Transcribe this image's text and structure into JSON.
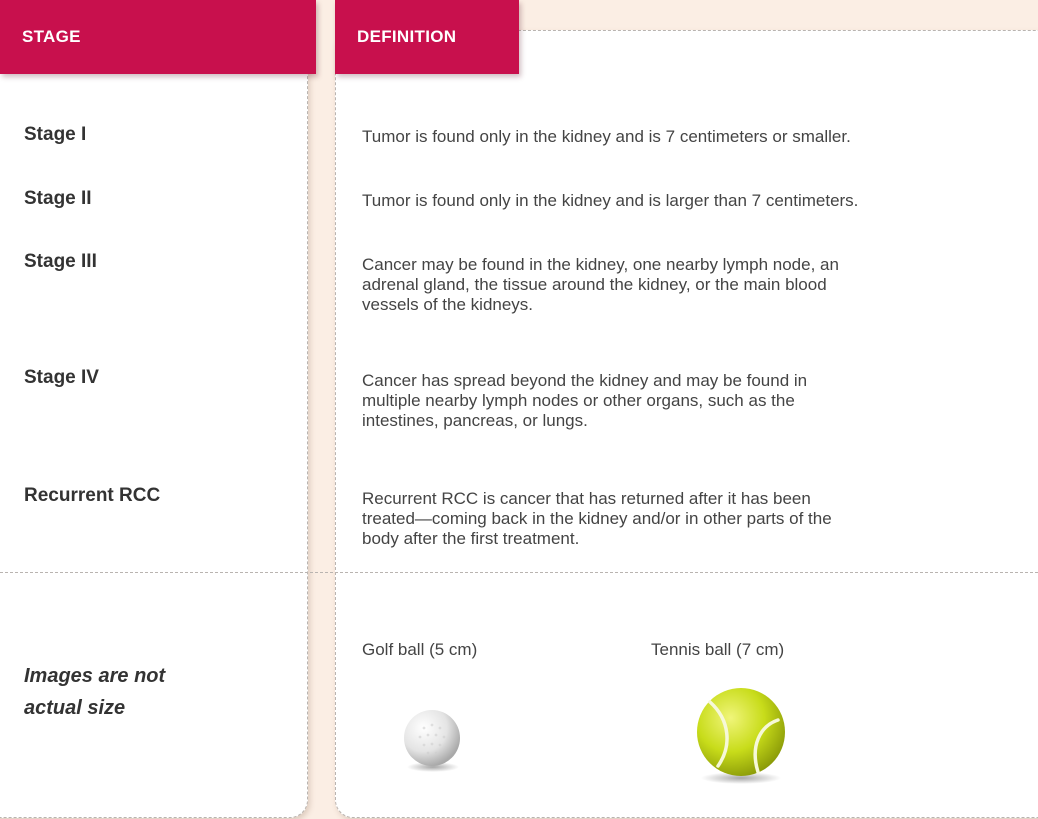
{
  "headers": {
    "stage": "STAGE",
    "definition": "DEFINITION"
  },
  "rows": [
    {
      "stage": "Stage I",
      "definition": "Tumor is found only in the kidney and is 7 centimeters or smaller."
    },
    {
      "stage": "Stage II",
      "definition": "Tumor is found only in the kidney and is larger than 7 centimeters."
    },
    {
      "stage": "Stage III",
      "definition": "Cancer may be found in the kidney, one nearby lymph node, an adrenal gland, the tissue around the kidney, or the main blood vessels of the kidneys."
    },
    {
      "stage": "Stage IV",
      "definition": "Cancer has spread beyond the kidney and may be found in multiple nearby lymph nodes or other organs, such as the intestines, pancreas, or lungs."
    },
    {
      "stage": "Recurrent RCC",
      "definition": "Recurrent RCC is cancer that has returned after it has been treated—coming back in the kidney and/or in other parts of the body after the first treatment."
    }
  ],
  "note": "Images are not actual size",
  "examples": [
    {
      "caption": "Golf ball (5 cm)",
      "icon": "golf-ball-icon",
      "color": "#e8e8e8"
    },
    {
      "caption": "Tennis ball (7 cm)",
      "icon": "tennis-ball-icon",
      "color": "#c8dc1a"
    }
  ],
  "colors": {
    "header": "#c8104d",
    "background": "#fbeee4"
  }
}
